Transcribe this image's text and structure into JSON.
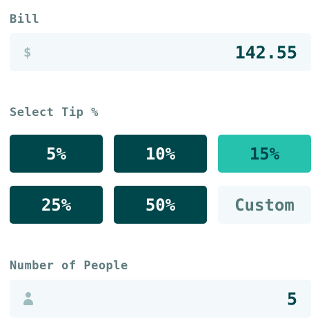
{
  "bill": {
    "label": "Bill",
    "currency_symbol": "$",
    "value": "142.55"
  },
  "tip": {
    "label": "Select Tip %",
    "options": [
      {
        "label": "5%",
        "state": "default"
      },
      {
        "label": "10%",
        "state": "default"
      },
      {
        "label": "15%",
        "state": "selected"
      },
      {
        "label": "25%",
        "state": "default"
      },
      {
        "label": "50%",
        "state": "default"
      }
    ],
    "custom_placeholder": "Custom"
  },
  "people": {
    "label": "Number of People",
    "icon": "person-icon",
    "value": "5"
  },
  "colors": {
    "dark_teal": "#00474b",
    "accent": "#26c2ae",
    "label_gray": "#5e7a7d",
    "field_bg": "#f3f8fb",
    "icon_gray": "#9ebbbd"
  }
}
